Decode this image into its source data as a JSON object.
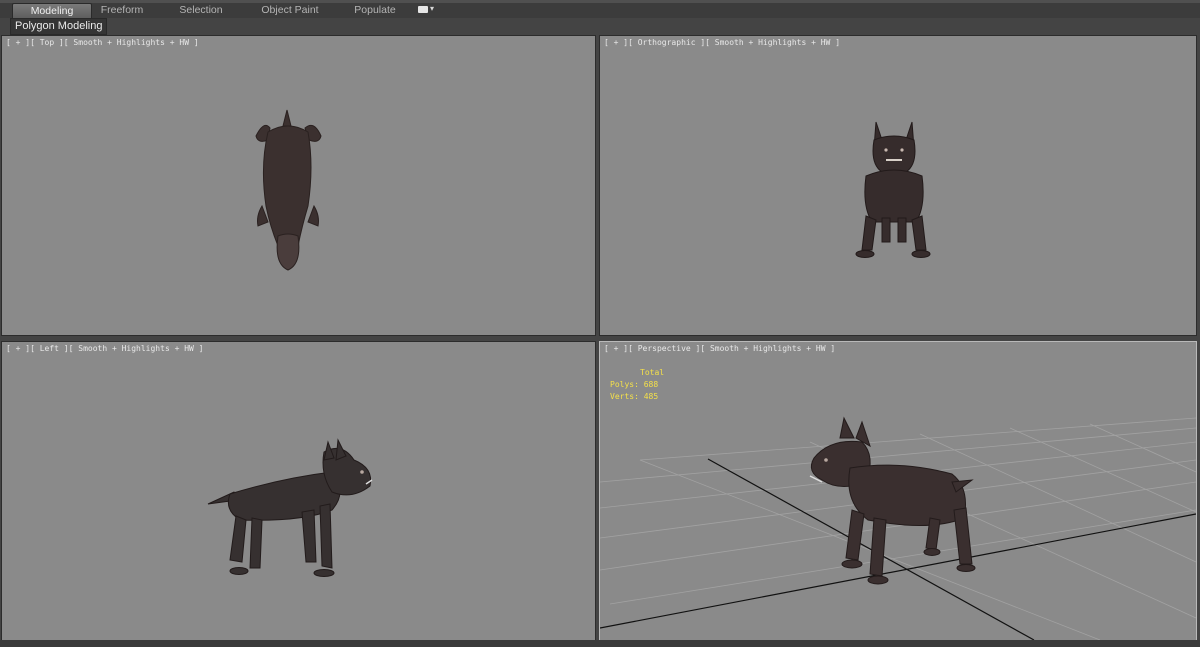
{
  "ribbon": {
    "tabs": [
      "Modeling",
      "Freeform",
      "Selection",
      "Object Paint",
      "Populate"
    ],
    "active_tab": "Modeling",
    "panel_label": "Polygon Modeling",
    "extra_icon": "camera-icon"
  },
  "viewports": {
    "top": {
      "label": "[ + ][ Top ][ Smooth + Highlights + HW ]"
    },
    "ortho": {
      "label": "[ + ][ Orthographic ][ Smooth + Highlights + HW ]"
    },
    "left": {
      "label": "[ + ][ Left ][ Smooth + Highlights + HW ]"
    },
    "persp": {
      "label": "[ + ][ Perspective ][ Smooth + Highlights + HW ]"
    }
  },
  "stats": {
    "header": "Total",
    "polys_label": "Polys:",
    "polys_value": "688",
    "verts_label": "Verts:",
    "verts_value": "485"
  },
  "colors": {
    "viewport_bg": "#8a8a8a",
    "model": "#3a2f2f",
    "stats_text": "#f4e04a",
    "active_viewport_border": "#b9b9b9"
  }
}
